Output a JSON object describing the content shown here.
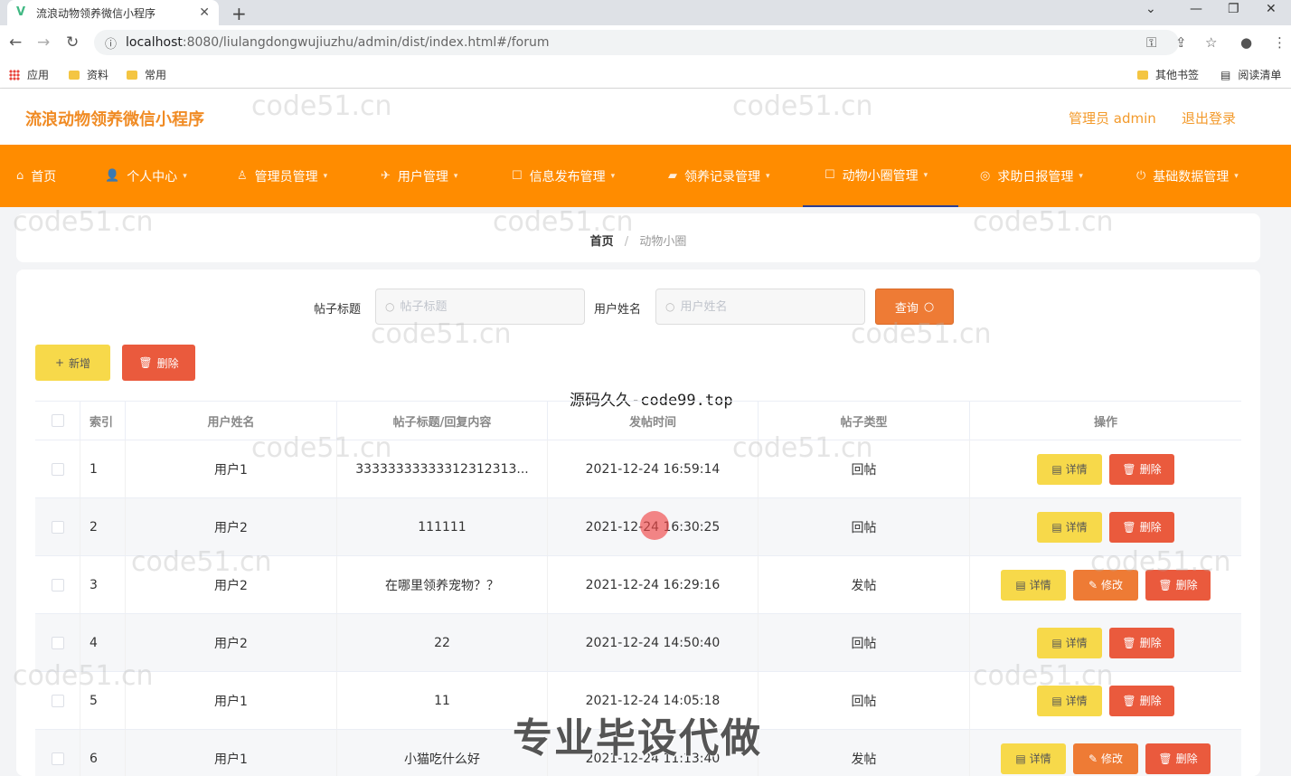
{
  "browser": {
    "tab_title": "流浪动物领养微信小程序",
    "url_host": "localhost",
    "url_path": ":8080/liulangdongwujiuzhu/admin/dist/index.html#/forum",
    "bookmarks": [
      "应用",
      "资料",
      "常用",
      "其他书签",
      "阅读清单"
    ]
  },
  "header": {
    "app_title": "流浪动物领养微信小程序",
    "admin_label": "管理员 admin",
    "logout": "退出登录"
  },
  "menu": [
    {
      "label": "首页",
      "icon": "home-icon"
    },
    {
      "label": "个人中心",
      "icon": "user-icon"
    },
    {
      "label": "管理员管理",
      "icon": "admin-icon"
    },
    {
      "label": "用户管理",
      "icon": "users-icon"
    },
    {
      "label": "信息发布管理",
      "icon": "info-icon"
    },
    {
      "label": "领养记录管理",
      "icon": "record-icon"
    },
    {
      "label": "动物小圈管理",
      "icon": "forum-icon"
    },
    {
      "label": "求助日报管理",
      "icon": "help-icon"
    },
    {
      "label": "基础数据管理",
      "icon": "data-icon"
    }
  ],
  "breadcrumb": {
    "home": "首页",
    "current": "动物小圈"
  },
  "search": {
    "title_label": "帖子标题",
    "title_placeholder": "帖子标题",
    "user_label": "用户姓名",
    "user_placeholder": "用户姓名",
    "query_button": "查询"
  },
  "actions": {
    "add": "新增",
    "delete": "删除"
  },
  "watermark": "源码久久-code99.top",
  "table": {
    "headers": {
      "index": "索引",
      "user": "用户姓名",
      "title": "帖子标题/回复内容",
      "time": "发帖时间",
      "type": "帖子类型",
      "ops": "操作"
    },
    "op_labels": {
      "detail": "详情",
      "edit": "修改",
      "delete": "删除"
    },
    "rows": [
      {
        "index": "1",
        "user": "用户1",
        "title": "3333333333331231231​3...",
        "time": "2021-12-24 16:59:14",
        "type": "回帖"
      },
      {
        "index": "2",
        "user": "用户2",
        "title": "111111",
        "time": "2021-12-24 16:30:25",
        "type": "回帖"
      },
      {
        "index": "3",
        "user": "用户2",
        "title": "在哪里领养宠物？？",
        "time": "2021-12-24 16:29:16",
        "type": "发帖"
      },
      {
        "index": "4",
        "user": "用户2",
        "title": "22",
        "time": "2021-12-24 14:50:40",
        "type": "回帖"
      },
      {
        "index": "5",
        "user": "用户1",
        "title": "11",
        "time": "2021-12-24 14:05:18",
        "type": "回帖"
      },
      {
        "index": "6",
        "user": "用户1",
        "title": "小猫吃什么好",
        "time": "2021-12-24 11:13:40",
        "type": "发帖"
      }
    ]
  },
  "banner": "专业毕设代做",
  "bg_watermark": "code51.cn"
}
